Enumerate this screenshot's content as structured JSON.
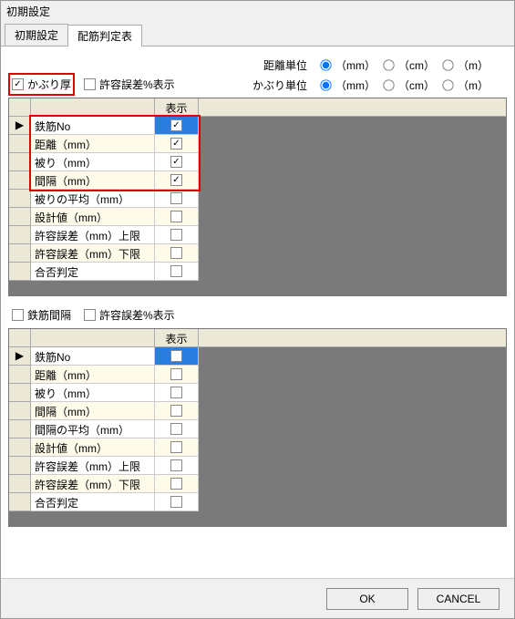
{
  "window": {
    "title": "初期設定"
  },
  "tabs": [
    {
      "label": "初期設定",
      "active": false
    },
    {
      "label": "配筋判定表",
      "active": true
    }
  ],
  "upper": {
    "distance_unit_label": "距離単位",
    "cover_unit_label": "かぶり単位",
    "units": {
      "mm": "（mm）",
      "cm": "（cm）",
      "m": "（m）"
    },
    "distance_unit_value": "mm",
    "cover_unit_value": "mm",
    "check_cover": {
      "label": "かぶり厚",
      "checked": true
    },
    "check_tolerance": {
      "label": "許容誤差%表示",
      "checked": false
    },
    "grid": {
      "header_display": "表示",
      "rows": [
        {
          "name": "鉄筋No",
          "display": true,
          "selected": true
        },
        {
          "name": "距離（mm）",
          "display": true
        },
        {
          "name": "被り（mm）",
          "display": true
        },
        {
          "name": "間隔（mm）",
          "display": true
        },
        {
          "name": "被りの平均（mm）",
          "display": false
        },
        {
          "name": "設計値（mm）",
          "display": false
        },
        {
          "name": "許容誤差（mm）上限",
          "display": false
        },
        {
          "name": "許容誤差（mm）下限",
          "display": false
        },
        {
          "name": "合否判定",
          "display": false
        }
      ]
    }
  },
  "lower": {
    "check_spacing": {
      "label": "鉄筋間隔",
      "checked": false
    },
    "check_tolerance": {
      "label": "許容誤差%表示",
      "checked": false
    },
    "grid": {
      "header_display": "表示",
      "rows": [
        {
          "name": "鉄筋No",
          "display": false,
          "selected": true
        },
        {
          "name": "距離（mm）",
          "display": false
        },
        {
          "name": "被り（mm）",
          "display": false
        },
        {
          "name": "間隔（mm）",
          "display": false
        },
        {
          "name": "間隔の平均（mm）",
          "display": false
        },
        {
          "name": "設計値（mm）",
          "display": false
        },
        {
          "name": "許容誤差（mm）上限",
          "display": false
        },
        {
          "name": "許容誤差（mm）下限",
          "display": false
        },
        {
          "name": "合否判定",
          "display": false
        }
      ]
    }
  },
  "footer": {
    "ok": "OK",
    "cancel": "CANCEL"
  },
  "highlights": "red annotation boxes around 'かぶり厚' checkbox and first four grid rows"
}
